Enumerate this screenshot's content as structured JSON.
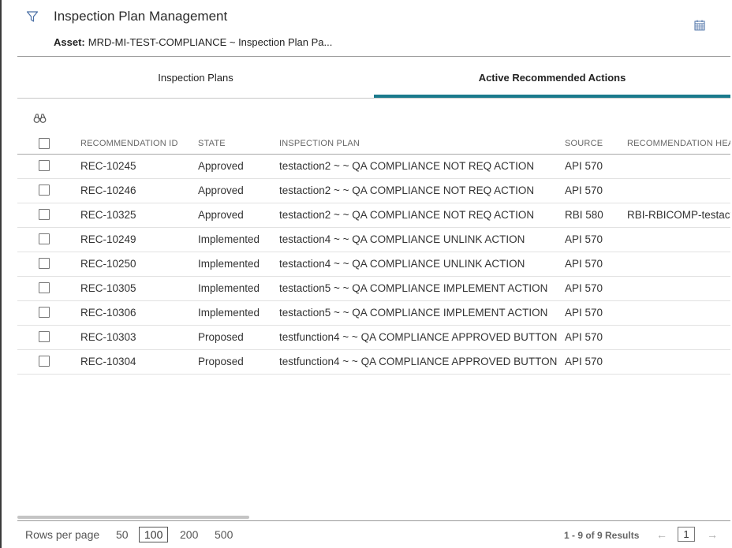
{
  "header": {
    "title": "Inspection Plan Management",
    "asset_label": "Asset:",
    "asset_value": "MRD-MI-TEST-COMPLIANCE ~ Inspection Plan Pa..."
  },
  "tabs": [
    {
      "label": "Inspection Plans",
      "active": false
    },
    {
      "label": "Active Recommended Actions",
      "active": true
    }
  ],
  "grid": {
    "columns": [
      "RECOMMENDATION ID",
      "STATE",
      "INSPECTION PLAN",
      "SOURCE",
      "RECOMMENDATION HEAD"
    ],
    "rows": [
      {
        "id": "REC-10245",
        "state": "Approved",
        "plan": "testaction2 ~ ~ QA COMPLIANCE NOT REQ ACTION",
        "source": "API 570",
        "headline": ""
      },
      {
        "id": "REC-10246",
        "state": "Approved",
        "plan": "testaction2 ~ ~ QA COMPLIANCE NOT REQ ACTION",
        "source": "API 570",
        "headline": ""
      },
      {
        "id": "REC-10325",
        "state": "Approved",
        "plan": "testaction2 ~ ~ QA COMPLIANCE NOT REQ ACTION",
        "source": "RBI 580",
        "headline": "RBI-RBICOMP-testact"
      },
      {
        "id": "REC-10249",
        "state": "Implemented",
        "plan": "testaction4 ~ ~ QA COMPLIANCE UNLINK ACTION",
        "source": "API 570",
        "headline": ""
      },
      {
        "id": "REC-10250",
        "state": "Implemented",
        "plan": "testaction4 ~ ~ QA COMPLIANCE UNLINK ACTION",
        "source": "API 570",
        "headline": ""
      },
      {
        "id": "REC-10305",
        "state": "Implemented",
        "plan": "testaction5 ~ ~ QA COMPLIANCE IMPLEMENT ACTION",
        "source": "API 570",
        "headline": ""
      },
      {
        "id": "REC-10306",
        "state": "Implemented",
        "plan": "testaction5 ~ ~ QA COMPLIANCE IMPLEMENT ACTION",
        "source": "API 570",
        "headline": ""
      },
      {
        "id": "REC-10303",
        "state": "Proposed",
        "plan": "testfunction4 ~ ~ QA COMPLIANCE APPROVED BUTTON",
        "source": "API 570",
        "headline": ""
      },
      {
        "id": "REC-10304",
        "state": "Proposed",
        "plan": "testfunction4 ~ ~ QA COMPLIANCE APPROVED BUTTON",
        "source": "API 570",
        "headline": ""
      }
    ]
  },
  "footer": {
    "rows_per_page_label": "Rows per page",
    "options": [
      "50",
      "100",
      "200",
      "500"
    ],
    "selected_option": "100",
    "results": "1 - 9 of 9 Results",
    "current_page": "1",
    "prev_arrow": "←",
    "next_arrow": "→"
  },
  "colors": {
    "accent": "#1a7a8c",
    "icon": "#4a6fa5"
  },
  "icons": [
    "filter-icon",
    "calendar-icon",
    "binoculars-icon"
  ]
}
